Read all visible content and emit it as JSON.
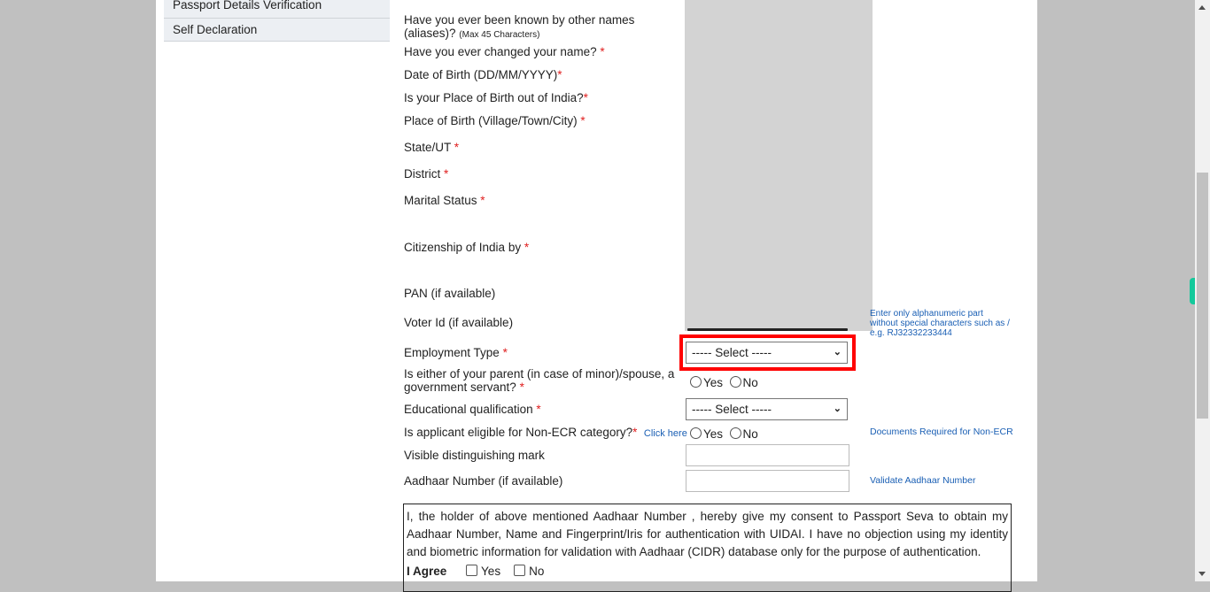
{
  "sidebar": {
    "items": [
      {
        "label": "Passport Details Verification"
      },
      {
        "label": "Self Declaration"
      }
    ]
  },
  "form": {
    "aliases_label": "Have you ever been known by other names",
    "aliases_label_2": "(aliases)?",
    "aliases_hint": "(Max 45 Characters)",
    "changed_name_label": "Have you ever changed your name?",
    "dob_label": "Date of Birth (DD/MM/YYYY)",
    "pob_out_label": "Is your Place of Birth out of India?",
    "pob_label": "Place of Birth (Village/Town/City)",
    "state_label": "State/UT",
    "district_label": "District",
    "marital_label": "Marital Status",
    "citizenship_label": "Citizenship of India by",
    "pan_label": "PAN (if available)",
    "voter_label": "Voter Id (if available)",
    "voter_hint_1": "Enter only alphanumeric part",
    "voter_hint_2": "without special characters such as /",
    "voter_hint_3": "e.g. RJ32332233444",
    "employment_label": "Employment Type",
    "employment_value": "----- Select -----",
    "govt_label_1": "Is either of your parent (in case of minor)/spouse, a",
    "govt_label_2": "government servant?",
    "education_label": "Educational qualification",
    "education_value": "----- Select -----",
    "nonecr_label": "Is applicant eligible for Non-ECR category?",
    "nonecr_link": "Click here",
    "nonecr_docs_link": "Documents Required for Non-ECR",
    "mark_label": "Visible distinguishing mark",
    "mark_value": "",
    "aadhaar_label": "Aadhaar Number (if available)",
    "aadhaar_value": "",
    "aadhaar_validate_link": "Validate Aadhaar Number",
    "required_mark": "*",
    "yes": "Yes",
    "no": "No"
  },
  "consent": {
    "text": "I, the holder of above mentioned Aadhaar Number , hereby give my consent to Passport Seva to obtain my Aadhaar Number, Name and Fingerprint/Iris for authentication with UIDAI. I have no objection using my identity and biometric information for validation with Aadhaar (CIDR) database only for the purpose of authentication.",
    "agree_label": "I Agree",
    "yes": "Yes",
    "no": "No"
  },
  "colors": {
    "highlight": "#ff0000",
    "link": "#1a5fb4",
    "required": "#e02020",
    "accent_tab": "#13c99b"
  }
}
